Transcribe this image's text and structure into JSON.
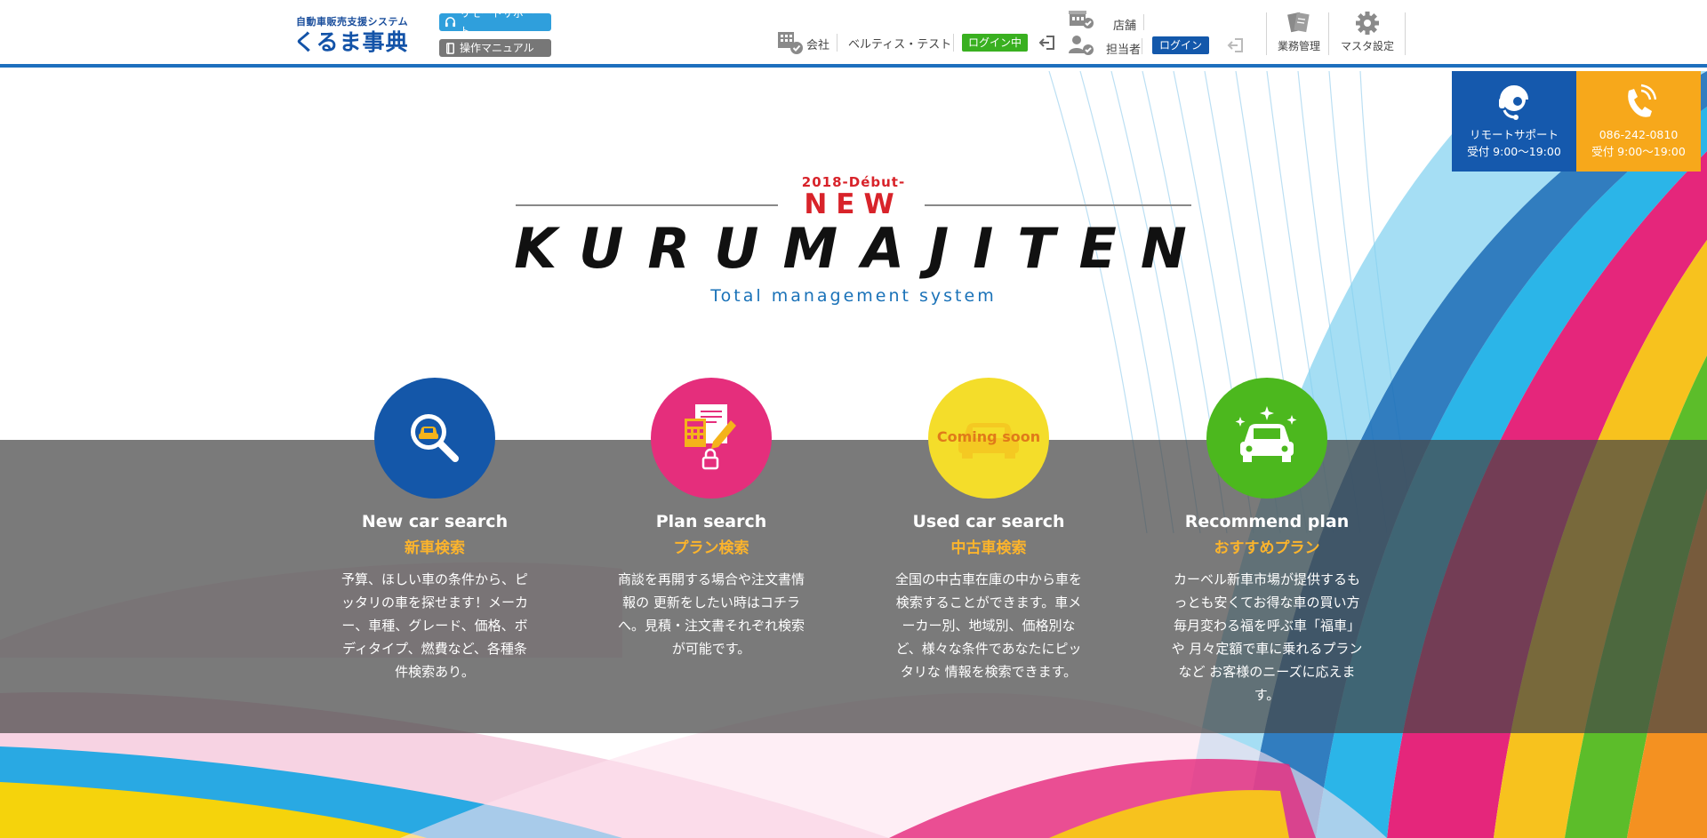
{
  "header": {
    "logo_sub": "自動車販売支援システム",
    "logo_main": "くるま事典",
    "remote_support_label": "リモートサポート",
    "manual_label": "操作マニュアル",
    "company_label": "会社",
    "company_name": "ベルティス・テスト",
    "company_status": "ログイン中",
    "store_label": "店舗",
    "staff_label": "担当者",
    "staff_login": "ログイン",
    "business_label": "業務管理",
    "master_label": "マスタ設定"
  },
  "support": {
    "remote_title": "リモートサポート",
    "remote_hours": "受付 9:00〜19:00",
    "phone_number": "086-242-0810",
    "phone_hours": "受付 9:00〜19:00"
  },
  "hero": {
    "debut": "2018-Début-",
    "new": "NEW",
    "brand": "KURUMAJITEN",
    "tagline": "Total management system"
  },
  "features": [
    {
      "title_en": "New car search",
      "title_jp": "新車検索",
      "desc": "予算、ほしい車の条件から、ピッタリの車を探せます！メーカー、車種、グレード、価格、ボディタイプ、燃費など、各種条件検索あり。",
      "icon": "car-search-icon",
      "color": "#1457a9"
    },
    {
      "title_en": "Plan search",
      "title_jp": "プラン検索",
      "desc": "商談を再開する場合や注文書情報の 更新をしたい時はコチラへ。見積・注文書それぞれ検索が可能です。",
      "icon": "document-calculator-icon",
      "color": "#e52e7c"
    },
    {
      "title_en": "Used car search",
      "title_jp": "中古車検索",
      "desc": "全国の中古車在庫の中から車を検索することができます。車メーカー別、地域別、価格別など、様々な条件であなたにピッタリな 情報を検索できます。",
      "icon": "car-icon",
      "color": "#f4dd2a",
      "overlay": "Coming soon"
    },
    {
      "title_en": "Recommend plan",
      "title_jp": "おすすめプラン",
      "desc": "カーベル新車市場が提供するもっとも安くてお得な車の買い方 毎月変わる福を呼ぶ車「福車」や 月々定額で車に乗れるプランなど お客様のニーズに応えます。",
      "icon": "sparkle-car-icon",
      "color": "#4cb81e"
    }
  ]
}
